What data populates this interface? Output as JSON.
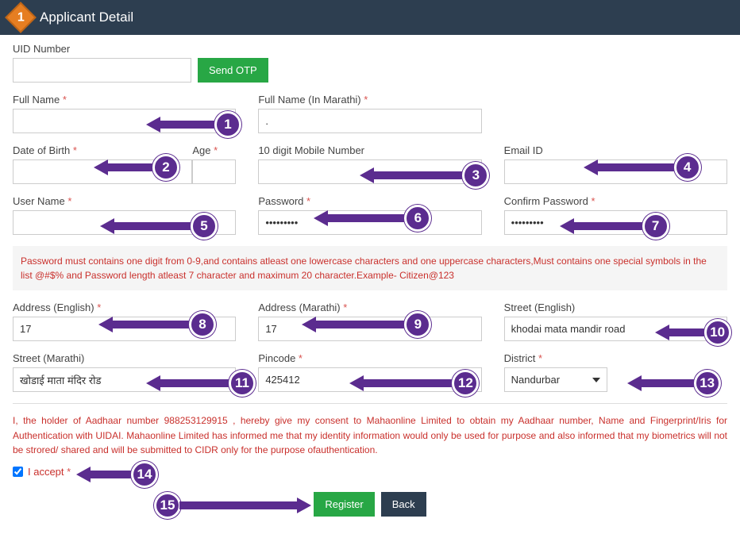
{
  "header": {
    "step_number": "1",
    "title": "Applicant Detail"
  },
  "fields": {
    "uid_label": "UID Number",
    "uid_value": "",
    "send_otp_label": "Send OTP",
    "fullname_label": "Full Name",
    "fullname_value": "",
    "fullname_mr_label": "Full Name (In Marathi)",
    "fullname_mr_value": ".",
    "dob_label": "Date of Birth",
    "dob_value": "",
    "age_label": "Age",
    "age_value": "",
    "mobile_label": "10 digit Mobile Number",
    "mobile_value": "",
    "email_label": "Email ID",
    "email_value": "",
    "username_label": "User Name",
    "username_value": "",
    "password_label": "Password",
    "password_value": "•••••••••",
    "confirm_password_label": "Confirm Password",
    "confirm_password_value": "•••••••••",
    "password_hint": "Password must contains one digit from 0-9,and contains atleast one lowercase characters and one uppercase characters,Must contains one special symbols in the list @#$% and Password length atleast 7 character and maximum 20 character.Example- Citizen@123",
    "addr_en_label": "Address (English)",
    "addr_en_value": "17",
    "addr_mr_label": "Address (Marathi)",
    "addr_mr_value": "17",
    "street_en_label": "Street (English)",
    "street_en_value": "khodai mata mandir road",
    "street_mr_label": "Street (Marathi)",
    "street_mr_value": "खोडाई माता मंदिर रोड",
    "pincode_label": "Pincode",
    "pincode_value": "425412",
    "district_label": "District",
    "district_value": "Nandurbar"
  },
  "consent": {
    "text": "I, the holder of Aadhaar number 988253129915 , hereby give my consent to Mahaonline Limited to obtain my Aadhaar number, Name and Fingerprint/Iris for Authentication with UIDAI. Mahaonline Limited has informed me that my identity information would only be used for purpose and also informed that my biometrics will not be strored/ shared and will be submitted to CIDR only for the purpose ofauthentication.",
    "accept_label": "I accept",
    "accept_checked": true
  },
  "actions": {
    "register_label": "Register",
    "back_label": "Back"
  },
  "annotations": {
    "n1": "1",
    "n2": "2",
    "n3": "3",
    "n4": "4",
    "n5": "5",
    "n6": "6",
    "n7": "7",
    "n8": "8",
    "n9": "9",
    "n10": "10",
    "n11": "11",
    "n12": "12",
    "n13": "13",
    "n14": "14",
    "n15": "15"
  }
}
